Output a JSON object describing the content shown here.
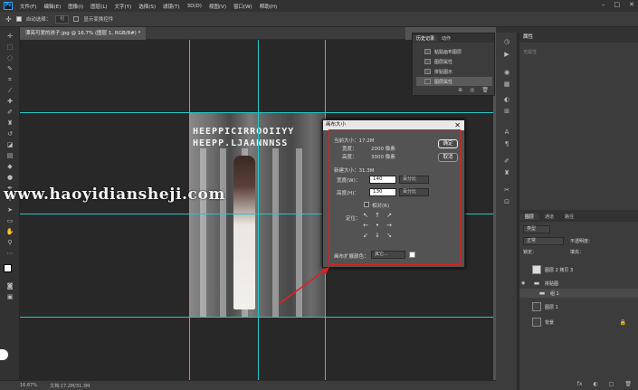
{
  "app": {
    "logo": "Ps"
  },
  "menu": [
    "文件(F)",
    "编辑(E)",
    "图像(I)",
    "图层(L)",
    "文字(Y)",
    "选择(S)",
    "滤镜(T)",
    "3D(D)",
    "视图(V)",
    "窗口(W)",
    "帮助(H)"
  ],
  "window_controls": [
    "–",
    "□",
    "✕"
  ],
  "options": {
    "auto_select": "自动选择：",
    "auto_select_dd": "组",
    "show_transform": "显示变换控件"
  },
  "document_tab": "漂亮可爱的孩子.jpg @ 16.7% (图层 1, RGB/8#) *",
  "photo": {
    "title_line1": "HEEPPICIRROOIIYY",
    "title_line2": "HEEPP.LJAANNNSS"
  },
  "watermark": "www.haoyidiansheji.com",
  "history": {
    "tabs": [
      "历史记录",
      "动作"
    ],
    "items": [
      "粘贴画布图层",
      "图层属性",
      "拼贴图示",
      "图层属性"
    ],
    "footer": [
      "⊕",
      "◎",
      "🗑"
    ]
  },
  "dialog": {
    "title": "画布大小",
    "close": "✕",
    "current_size": "当前大小：17.2M",
    "width_label": "宽度：",
    "width_value": "2000 像素",
    "height_label": "高度：",
    "height_value": "3000 像素",
    "new_size": "新建大小：31.3M",
    "new_width_label": "宽度(W)：",
    "new_width_value": "140",
    "new_height_label": "高度(H)：",
    "new_height_value": "130",
    "unit": "百分比",
    "relative": "相对(R)",
    "anchor_label": "定位：",
    "anchor": [
      "↖",
      "↑",
      "↗",
      "←",
      "•",
      "→",
      "↙",
      "↓",
      "↘"
    ],
    "ok": "确定",
    "cancel": "取消",
    "ext_color_label": "画布扩展颜色：",
    "ext_color_value": "其它..."
  },
  "properties": {
    "title": "属性",
    "sub": "无属性"
  },
  "layers": {
    "tabs": [
      "图层",
      "通道",
      "路径"
    ],
    "kind": "类型",
    "mode": "正常",
    "opacity_label": "不透明度：",
    "lock_label": "锁定：",
    "fill_label": "填充：",
    "items": [
      {
        "name": "图层 2 拷贝 3",
        "thumb": "light"
      },
      {
        "name": "拼贴图",
        "thumb": "folder"
      },
      {
        "name": "组 1",
        "thumb": "folder"
      },
      {
        "name": "图层 1",
        "thumb": "dark"
      },
      {
        "name": "背景",
        "thumb": "dark"
      }
    ],
    "footer": [
      "fx",
      "◐",
      "□",
      "🗑"
    ]
  },
  "status": {
    "zoom": "16.67%",
    "doc": "文档:17.2M/31.3M"
  },
  "colors": {
    "guide": "#29c5c5",
    "dialog_outline": "#e02020",
    "accent": "#31a8ff"
  }
}
